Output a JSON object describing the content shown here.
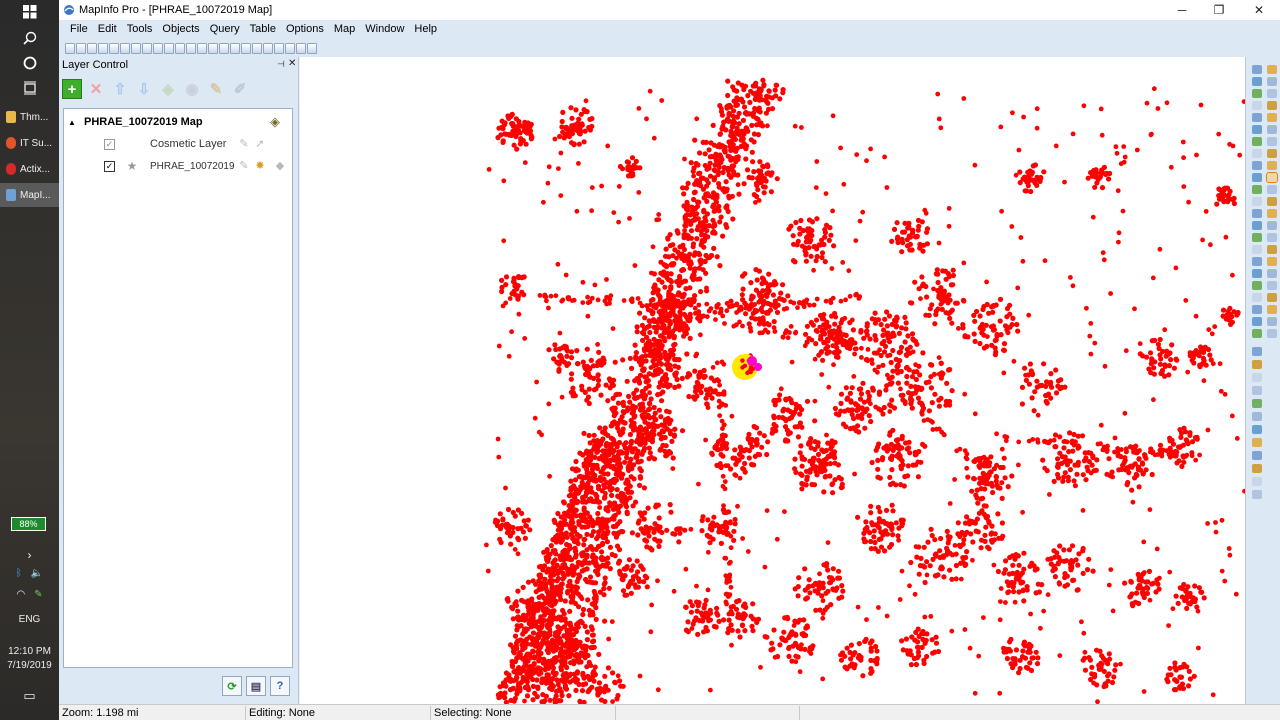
{
  "taskbar": {
    "apps": [
      "Thm...",
      "IT Su...",
      "Actix...",
      "MapI..."
    ],
    "battery": "88%",
    "language": "ENG",
    "time": "12:10 PM",
    "date": "7/19/2019"
  },
  "window": {
    "title": "MapInfo Pro - [PHRAE_10072019 Map]"
  },
  "menu": [
    "File",
    "Edit",
    "Tools",
    "Objects",
    "Query",
    "Table",
    "Options",
    "Map",
    "Window",
    "Help"
  ],
  "layer_control": {
    "title": "Layer Control",
    "map_name": "PHRAE_10072019 Map",
    "layers": [
      {
        "name": "Cosmetic Layer",
        "checked": true
      },
      {
        "name": "PHRAE_10072019",
        "checked": true
      }
    ]
  },
  "status": {
    "zoom": "Zoom: 1.198 mi",
    "editing": "Editing: None",
    "selecting": "Selecting: None"
  },
  "colors": {
    "points": "#ff0000",
    "highlight": "#ffe800",
    "cursor": "#ff00cc",
    "accent": "#dde8f5"
  }
}
